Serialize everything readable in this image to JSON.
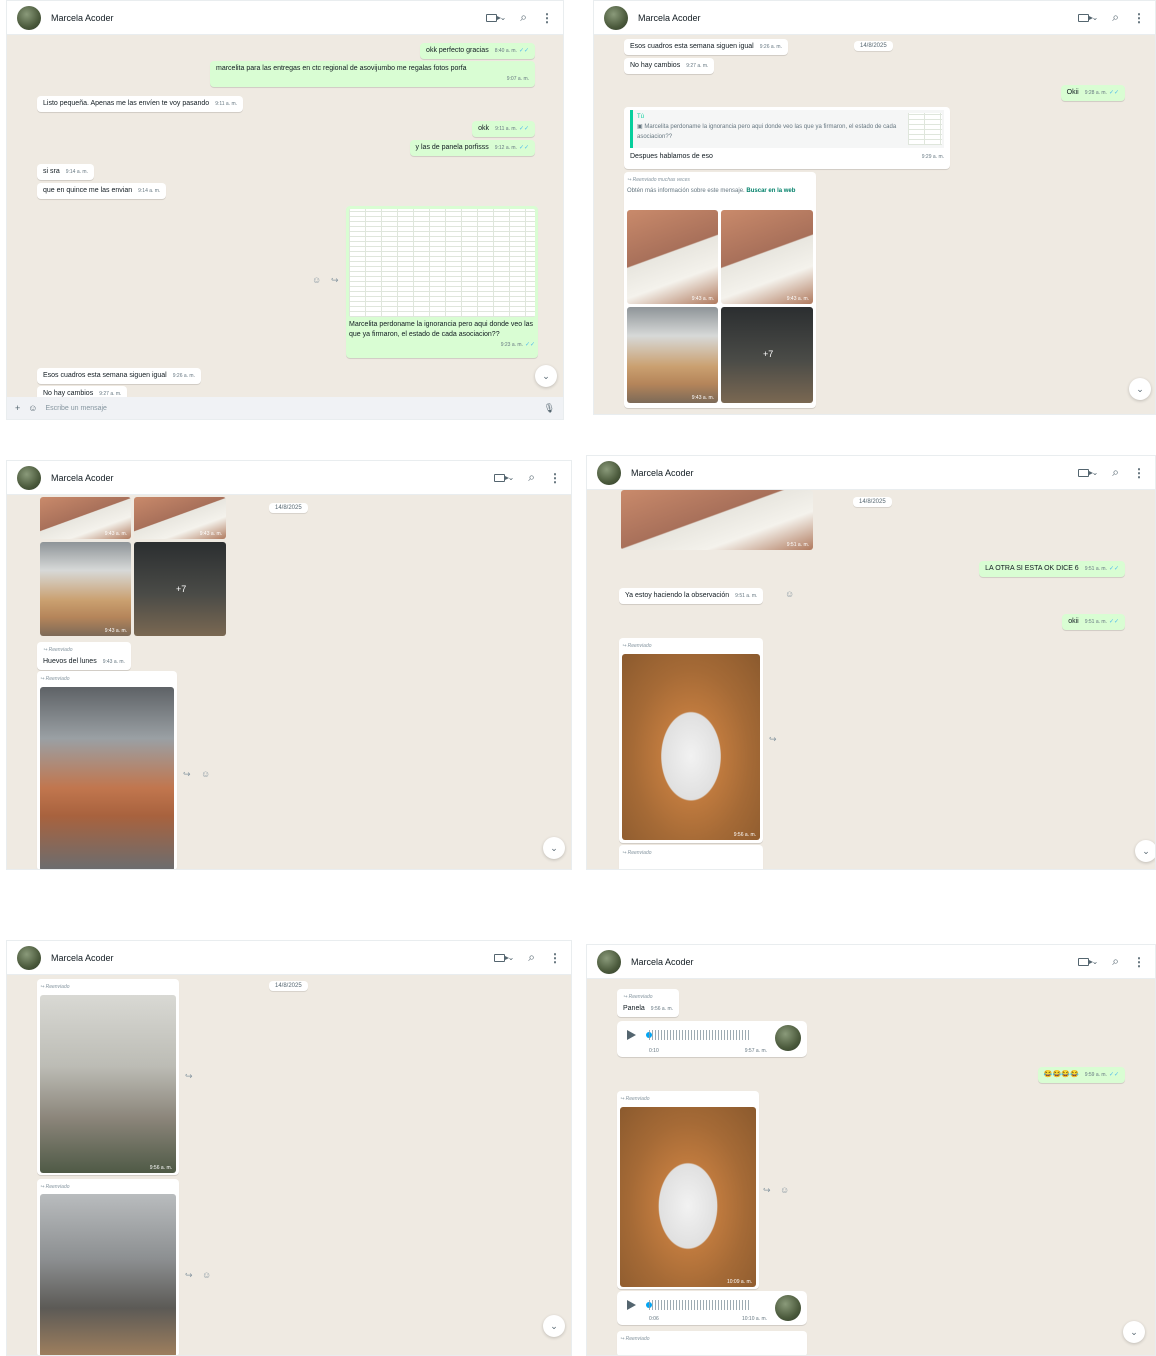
{
  "contact_name": "Marcela Acoder",
  "icons": {
    "video": "video-camera-icon",
    "chevron": "chevron-down-icon",
    "search": "search-icon",
    "menu": "kebab-menu-icon"
  },
  "date_separator": "14/8/2025",
  "composer_placeholder": "Escribe un mensaje",
  "p1": {
    "m1": {
      "text": "okk perfecto gracias",
      "time": "8:40 a. m."
    },
    "m2": {
      "text": "marcelita para las entregas en ctc regional de asovijumbo me regalas fotos porfa",
      "time": "9:07 a. m."
    },
    "m3": {
      "text": "Listo pequeña. Apenas me las envíen te voy pasando",
      "time": "9:11 a. m."
    },
    "m4": {
      "text": "okk",
      "time": "9:11 a. m."
    },
    "m5": {
      "text": "y las de panela porfisss",
      "time": "9:12 a. m."
    },
    "m6": {
      "text": "si sra",
      "time": "9:14 a. m."
    },
    "m7": {
      "text": "que en quince me las envian",
      "time": "9:14 a. m."
    },
    "m8": {
      "text": "Marcelita perdoname la ignorancia pero aqui donde veo las que ya firmaron, el estado de cada asociacion??",
      "time": "9:23 a. m."
    },
    "m9": {
      "text": "Esos cuadros esta semana siguen igual",
      "time": "9:26 a. m."
    },
    "m10": {
      "text": "No hay cambios",
      "time": "9:27 a. m."
    }
  },
  "p2": {
    "m1": {
      "text": "Esos cuadros esta semana siguen igual",
      "time": "9:26 a. m."
    },
    "m2": {
      "text": "No hay cambios",
      "time": "9:27 a. m."
    },
    "m3": {
      "text": "Okii",
      "time": "9:28 a. m."
    },
    "quote_author": "Tú",
    "quote_text": "Marcelita perdoname la ignorancia pero aqui donde veo las que ya firmaron, el estado de cada asociacion??",
    "m4": {
      "text": "Despues hablamos de eso",
      "time": "9:29 a. m."
    },
    "fwd_many": "Reenviado muchas veces",
    "info_text": "Obtén más información sobre este mensaje.",
    "info_link": "Buscar en la web",
    "photo_time": "9:43 a. m.",
    "more_count": "+7"
  },
  "p3": {
    "photo_time": "9:43 a. m.",
    "more_count": "+7",
    "fwd": "Reenviado",
    "m1": {
      "text": "Huevos del lunes",
      "time": "9:43 a. m."
    }
  },
  "p4": {
    "m1": {
      "text": "LA OTRA SI ESTA OK DICE 6",
      "time": "9:51 a. m."
    },
    "m2": {
      "text": "Ya estoy haciendo la observación",
      "time": "9:51 a. m."
    },
    "m3": {
      "text": "okii",
      "time": "9:51 a. m."
    },
    "photo1_time": "9:51 a. m.",
    "fwd": "Reenviado",
    "photo2_time": "9:56 a. m."
  },
  "p5": {
    "fwd": "Reenviado",
    "photo1_time": "9:56 a. m."
  },
  "p6": {
    "fwd": "Reenviado",
    "m1": {
      "text": "Panela",
      "time": "9:56 a. m."
    },
    "voice1": {
      "duration": "0:10",
      "time": "9:57 a. m."
    },
    "m2": {
      "text": "😂😂😂😂",
      "time": "9:59 a. m."
    },
    "photo_time": "10:09 a. m.",
    "voice2": {
      "duration": "0:06",
      "time": "10:10 a. m."
    }
  }
}
